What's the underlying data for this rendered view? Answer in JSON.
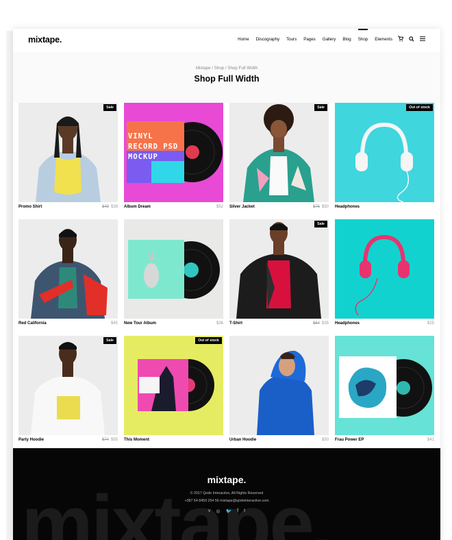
{
  "header": {
    "logo": "mixtape.",
    "nav": [
      "Home",
      "Discography",
      "Tours",
      "Pages",
      "Gallery",
      "Blog",
      "Shop",
      "Elements"
    ],
    "active_nav": "Shop",
    "icons": [
      "cart-icon",
      "search-icon",
      "menu-icon"
    ]
  },
  "title": {
    "breadcrumb": "Mixtape / Shop / Shop Full Width",
    "heading": "Shop Full Width"
  },
  "products": [
    {
      "name": "Promo Shirt",
      "old_price": "$49",
      "price": "$39",
      "badge": "Sale"
    },
    {
      "name": "Album Dream",
      "old_price": "",
      "price": "$52",
      "badge": ""
    },
    {
      "name": "Silver Jacket",
      "old_price": "$76",
      "price": "$50",
      "badge": "Sale"
    },
    {
      "name": "Headphones",
      "old_price": "",
      "price": "",
      "badge": "Out of stock"
    },
    {
      "name": "Red California",
      "old_price": "",
      "price": "$45",
      "badge": ""
    },
    {
      "name": "New Tour Album",
      "old_price": "",
      "price": "$36",
      "badge": ""
    },
    {
      "name": "T-Shirt",
      "old_price": "$64",
      "price": "$35",
      "badge": "Sale"
    },
    {
      "name": "Headphones",
      "old_price": "",
      "price": "$25",
      "badge": ""
    },
    {
      "name": "Party Hoodie",
      "old_price": "$74",
      "price": "$55",
      "badge": "Sale"
    },
    {
      "name": "This Moment",
      "old_price": "",
      "price": "",
      "badge": "Out of stock"
    },
    {
      "name": "Urban Hoodie",
      "old_price": "",
      "price": "$50",
      "badge": ""
    },
    {
      "name": "Frau Power EP",
      "old_price": "",
      "price": "$41",
      "badge": ""
    }
  ],
  "album_art_text": "VINYL RECORD PSD MOCKUP",
  "footer": {
    "logo": "mixtape.",
    "copyright": "© 2017 Qode Interactive, All Rights Reserved",
    "contact": "+387 64 8459 254 56   mixtape@qodeinteractive.com",
    "watermark": "mixtape.",
    "social": [
      "v",
      "◎",
      "🐦",
      "f",
      "t"
    ]
  },
  "colors": {
    "magenta": "#e84ad6",
    "teal": "#3fd6de",
    "mint": "#7ee8cf",
    "lime": "#e6ec61",
    "aqua": "#66e2d6"
  }
}
